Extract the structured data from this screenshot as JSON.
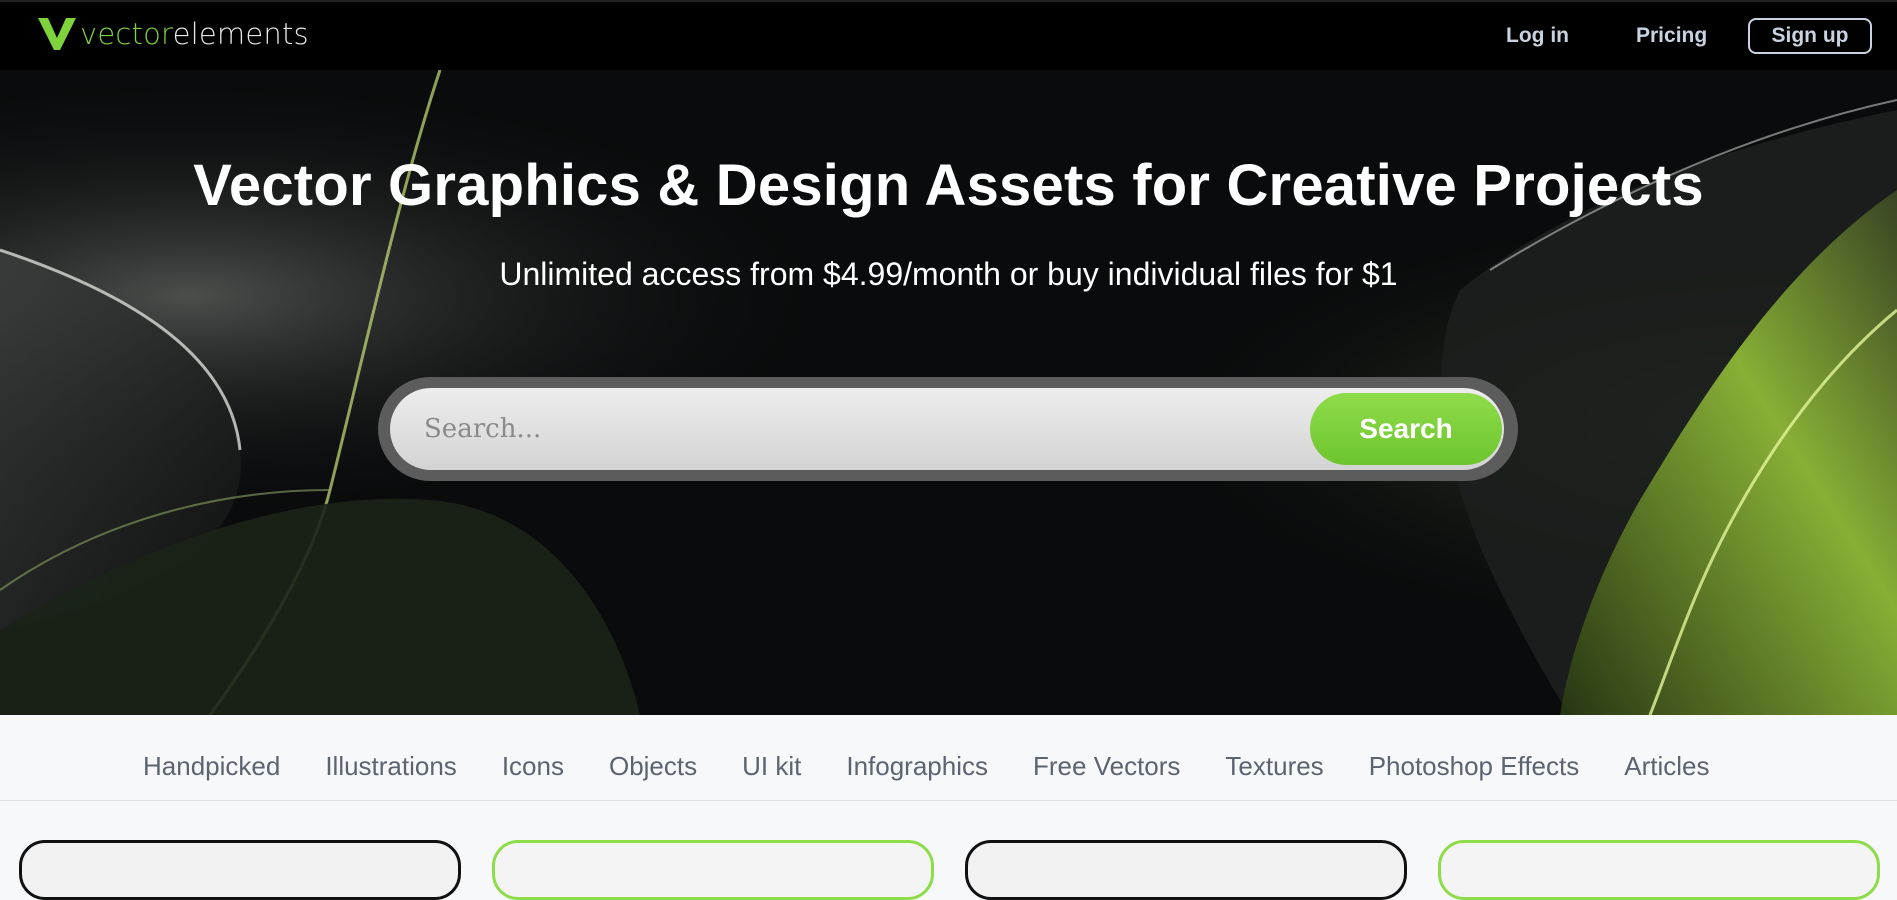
{
  "nav": {
    "logo_prefix": "vector",
    "logo_suffix": "elements",
    "login": "Log in",
    "pricing": "Pricing",
    "signup": "Sign up"
  },
  "hero": {
    "title": "Vector Graphics & Design Assets for Creative Projects",
    "subtitle": "Unlimited access from $4.99/month or buy individual files for $1",
    "search_placeholder": "Search...",
    "search_button": "Search"
  },
  "categories": [
    "Handpicked",
    "Illustrations",
    "Icons",
    "Objects",
    "UI kit",
    "Infographics",
    "Free Vectors",
    "Textures",
    "Photoshop Effects",
    "Articles"
  ],
  "colors": {
    "brand_green": "#7ed33c",
    "nav_text": "#c9d3e0",
    "background": "#000000"
  },
  "icons": [
    "logo-v-icon"
  ]
}
